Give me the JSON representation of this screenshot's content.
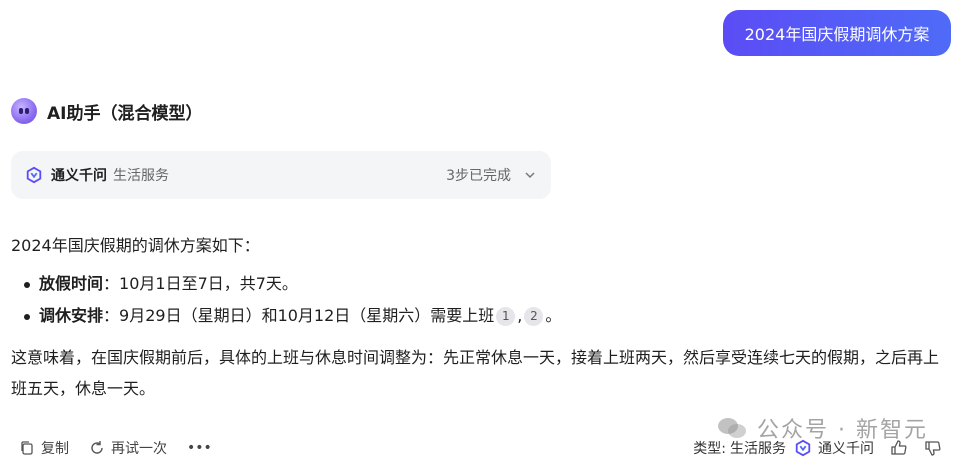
{
  "user_message": "2024年国庆假期调休方案",
  "assistant": {
    "avatar_icon": "robot-avatar-icon",
    "title": "AI助手（混合模型）"
  },
  "tool_card": {
    "icon": "tongyi-logo-icon",
    "name": "通义千问",
    "category": "生活服务",
    "status": "3步已完成"
  },
  "answer": {
    "intro": "2024年国庆假期的调休方案如下：",
    "bullets": [
      {
        "label": "放假时间",
        "sep": "：",
        "text": "10月1日至7日，共7天。",
        "citations": []
      },
      {
        "label": "调休安排",
        "sep": "：",
        "text": "9月29日（星期日）和10月12日（星期六）需要上班",
        "citations": [
          "1",
          "2"
        ],
        "tail": "。"
      }
    ],
    "summary": "这意味着，在国庆假期前后，具体的上班与休息时间调整为：先正常休息一天，接着上班两天，然后享受连续七天的假期，之后再上班五天，休息一天。"
  },
  "toolbar": {
    "copy_label": "复制",
    "retry_label": "再试一次",
    "more_label": "•••"
  },
  "meta": {
    "type_label": "类型:",
    "type_value": "生活服务",
    "model_name": "通义千问"
  },
  "watermark": "公众号 · 新智元",
  "colors": {
    "accent_start": "#5b4cf5",
    "accent_end": "#4f6bf7",
    "card_bg": "#f4f5f7"
  }
}
